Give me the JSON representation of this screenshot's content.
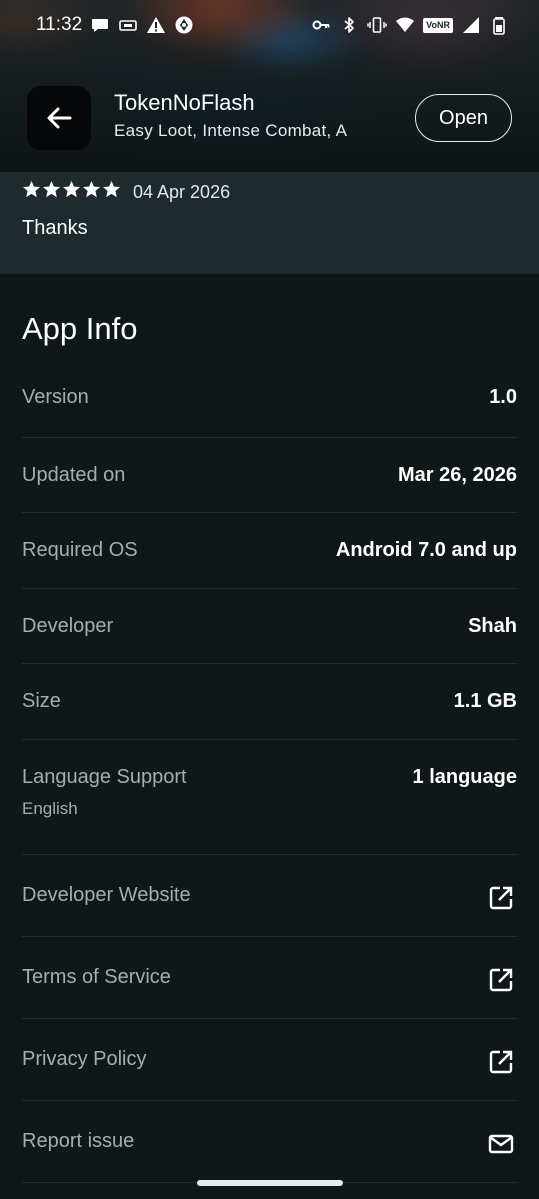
{
  "status_bar": {
    "time": "11:32",
    "left_icons": [
      "chat-bubble-icon",
      "sim-card-icon",
      "warning-icon",
      "aperture-icon"
    ],
    "right_icons": [
      "vpn-key-icon",
      "bluetooth-icon",
      "vibrate-icon",
      "wifi-icon",
      "volte-icon",
      "signal-icon",
      "battery-icon"
    ],
    "volte_label": "VoNR"
  },
  "app_bar": {
    "title": "TokenNoFlash",
    "subtitle": "Easy Loot, Intense Combat, A",
    "open_label": "Open",
    "back_icon": "arrow-back-icon"
  },
  "review": {
    "rating": 5,
    "date": "04 Apr 2026",
    "text": "Thanks"
  },
  "app_info": {
    "title": "App Info",
    "rows": [
      {
        "label": "Version",
        "value": "1.0"
      },
      {
        "label": "Updated on",
        "value": "Mar 26, 2026"
      },
      {
        "label": "Required OS",
        "value": "Android 7.0 and up"
      },
      {
        "label": "Developer",
        "value": "Shah"
      },
      {
        "label": "Size",
        "value": "1.1 GB"
      },
      {
        "label": "Language Support",
        "value": "1 language",
        "sub": "English"
      }
    ],
    "links": [
      {
        "label": "Developer Website",
        "icon": "open-external-icon"
      },
      {
        "label": "Terms of Service",
        "icon": "open-external-icon"
      },
      {
        "label": "Privacy Policy",
        "icon": "open-external-icon"
      },
      {
        "label": "Report issue",
        "icon": "mail-icon"
      }
    ]
  },
  "colors": {
    "background": "#0f1719",
    "review_card": "#1e2a2d",
    "label_text": "#9fb0b3",
    "divider": "#233033",
    "star": "#ffffff"
  }
}
